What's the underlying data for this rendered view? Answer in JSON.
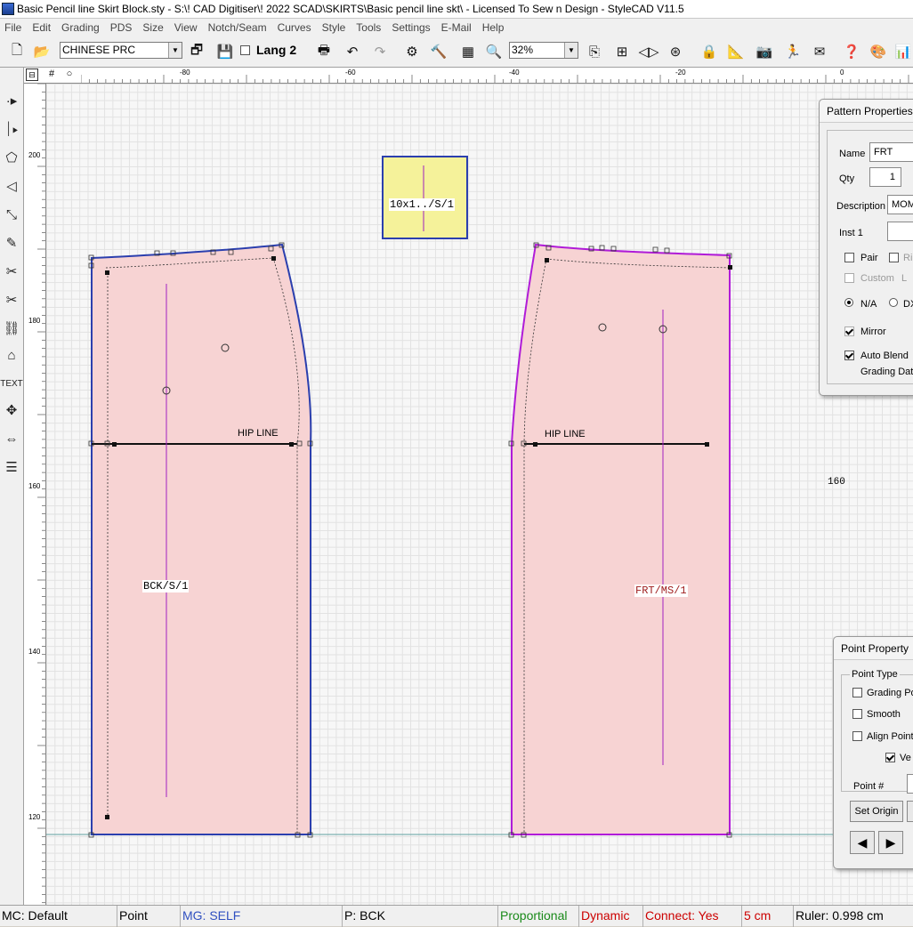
{
  "window": {
    "title": "Basic Pencil line Skirt Block.sty - S:\\! CAD Digitiser\\! 2022 SCAD\\SKIRTS\\Basic pencil line skt\\ - Licensed To Sew n Design - StyleCAD V11.5"
  },
  "menu": [
    "File",
    "Edit",
    "Grading",
    "PDS",
    "Size",
    "View",
    "Notch/Seam",
    "Curves",
    "Style",
    "Tools",
    "Settings",
    "E-Mail",
    "Help"
  ],
  "toolbar": {
    "language_combo": "CHINESE PRC",
    "lang2_label": "Lang 2",
    "lang2_checked": false,
    "zoom_value": "32%"
  },
  "rulers": {
    "h_labels": [
      "-80",
      "-60",
      "-40",
      "-20",
      "0"
    ],
    "v_labels": [
      "200",
      "180",
      "160",
      "140",
      "120"
    ]
  },
  "pieces": {
    "back_label": "BCK/S/1",
    "front_label": "FRT/MS/1",
    "small_label": "10x1../S/1",
    "hip_line": "HIP LINE",
    "canvas_number": "160"
  },
  "pattern_properties": {
    "title": "Pattern Properties",
    "name_label": "Name",
    "name_value": "FRT",
    "qty_label": "Qty",
    "qty_value": "1",
    "description_label": "Description",
    "description_value": "MOM",
    "inst1_label": "Inst 1",
    "inst1_value": "",
    "pair_label": "Pair",
    "pair_checked": false,
    "right_label": "Ri",
    "custom_label": "Custom",
    "custom_suffix": "L",
    "na_label": "N/A",
    "na_selected": true,
    "dx_label": "DX",
    "mirror_label": "Mirror",
    "mirror_checked": true,
    "auto_blend_label": "Auto Blend",
    "auto_blend_checked": true,
    "grading_data_label": "Grading Data"
  },
  "point_property": {
    "title": "Point Property",
    "point_type_label": "Point Type",
    "grading_label": "Grading Po",
    "grading_checked": false,
    "smooth_label": "Smooth",
    "smooth_checked": false,
    "align_label": "Align Point",
    "align_checked": false,
    "ve_label": "Ve",
    "ve_checked": true,
    "point_num_label": "Point #",
    "set_origin_label": "Set Origin"
  },
  "status": {
    "mc": "MC: Default",
    "mode": "Point",
    "mg": "MG: SELF",
    "piece": "P: BCK",
    "proportional": "Proportional",
    "dynamic": "Dynamic",
    "connect": "Connect: Yes",
    "step": "5 cm",
    "ruler": "Ruler: 0.998 cm"
  },
  "colors": {
    "piece_fill": "#f7d3d3",
    "back_outline": "#2b3fae",
    "front_outline": "#b01bd8",
    "small_fill": "#f5f29a",
    "green_status": "#1a8a1a",
    "red_status": "#cc0000",
    "blue_status": "#3050c0"
  }
}
